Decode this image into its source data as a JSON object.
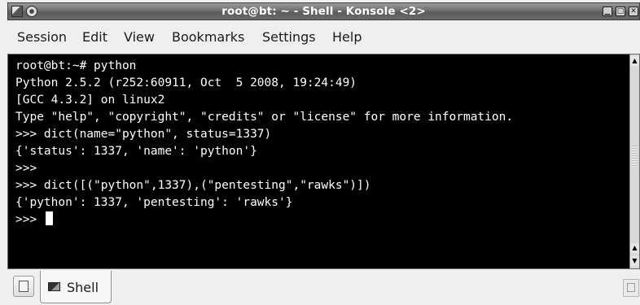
{
  "window": {
    "title": "root@bt: ~ - Shell - Konsole <2>",
    "minimize_glyph": "▁",
    "maximize_glyph": "□",
    "close_glyph": "✕"
  },
  "menu": {
    "items": [
      {
        "label": "Session"
      },
      {
        "label": "Edit"
      },
      {
        "label": "View"
      },
      {
        "label": "Bookmarks"
      },
      {
        "label": "Settings"
      },
      {
        "label": "Help"
      }
    ]
  },
  "terminal": {
    "lines": [
      "root@bt:~# python",
      "Python 2.5.2 (r252:60911, Oct  5 2008, 19:24:49)",
      "[GCC 4.3.2] on linux2",
      "Type \"help\", \"copyright\", \"credits\" or \"license\" for more information.",
      ">>> dict(name=\"python\", status=1337)",
      "{'status': 1337, 'name': 'python'}",
      ">>>",
      ">>> dict([(\"python\",1337),(\"pentesting\",\"rawks\")])",
      "{'python': 1337, 'pentesting': 'rawks'}",
      ">>> "
    ],
    "background": "#000000",
    "foreground": "#ffffff"
  },
  "scrollbar": {
    "up_glyph": "▲",
    "down_glyph": "▼"
  },
  "tabs": {
    "items": [
      {
        "label": "Shell",
        "icon": "terminal-icon"
      }
    ],
    "new_tab_icon": "new-tab-icon",
    "close_tab_icon": "close-tab-icon"
  }
}
